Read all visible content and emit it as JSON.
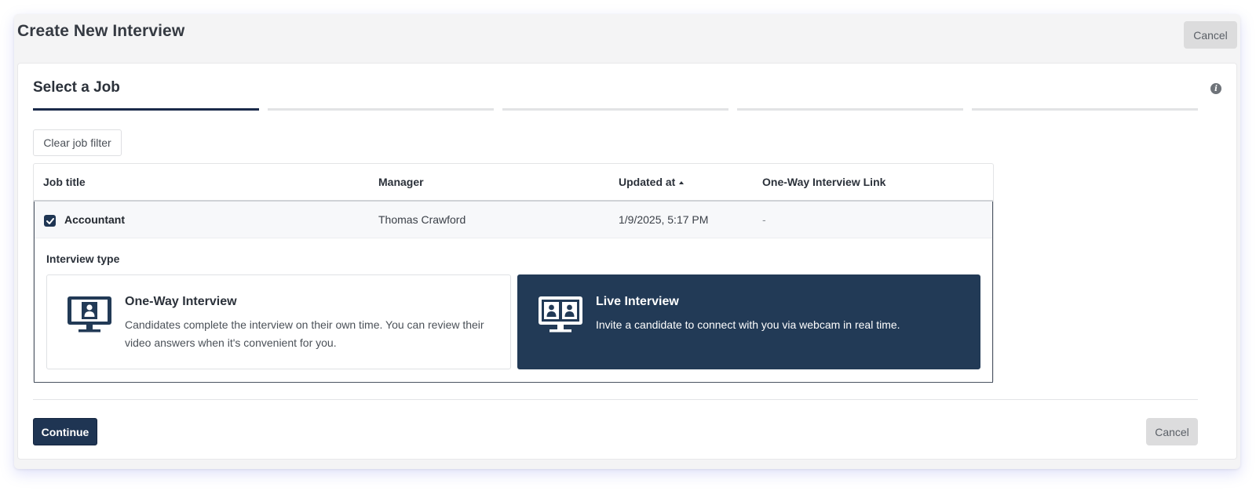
{
  "header": {
    "title": "Create New Interview",
    "cancel_label": "Cancel"
  },
  "step": {
    "title": "Select a Job",
    "info_icon": "info-icon",
    "total_steps": 5,
    "current_step": 1
  },
  "filters": {
    "clear_label": "Clear job filter"
  },
  "table": {
    "columns": [
      "Job title",
      "Manager",
      "Updated at",
      "One-Way Interview Link"
    ],
    "sort": {
      "column": "Updated at",
      "direction": "ascending"
    },
    "rows": [
      {
        "selected": true,
        "job_title": "Accountant",
        "manager": "Thomas Crawford",
        "updated_at": "1/9/2025, 5:17 PM",
        "link": "-"
      }
    ]
  },
  "interview_type": {
    "label": "Interview type",
    "options": [
      {
        "icon": "monitor-single-person-icon",
        "title": "One-Way Interview",
        "description": "Candidates complete the interview on their own time. You can review their video answers when it's convenient for you.",
        "selected": false
      },
      {
        "icon": "monitor-two-people-icon",
        "title": "Live Interview",
        "description": "Invite a candidate to connect with you via webcam in real time.",
        "selected": true
      }
    ]
  },
  "footer": {
    "continue_label": "Continue",
    "cancel_label": "Cancel"
  },
  "colors": {
    "primary": "#1f3553",
    "selected_card": "#223a56",
    "active_step": "#1b2a4a"
  }
}
